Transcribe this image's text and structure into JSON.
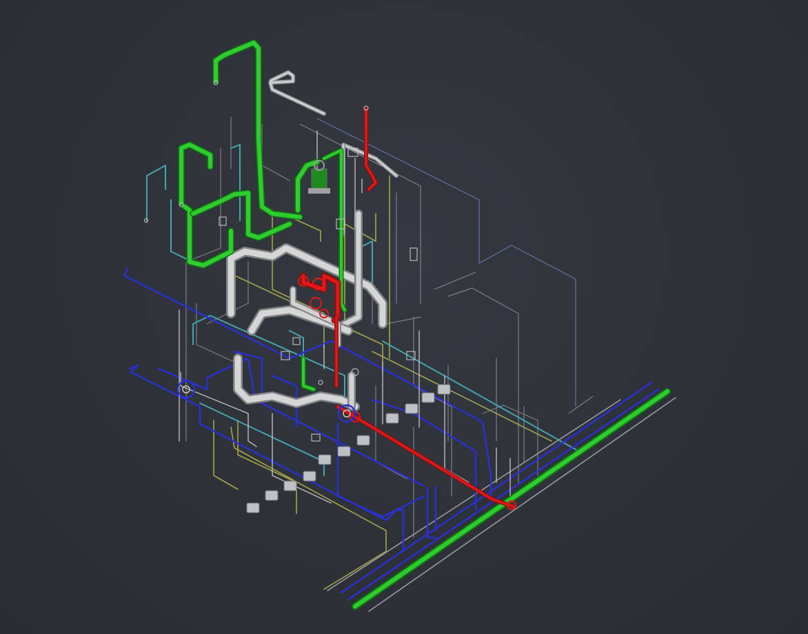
{
  "viewport": {
    "background": "#2e3238",
    "scene": "isometric-piping-model"
  },
  "colors": {
    "green": "#2ecc2e",
    "green_edge": "#0f7a0f",
    "blue": "#2a2fd6",
    "red": "#e01818",
    "cyan": "#46a6b0",
    "yellow": "#a8a64a",
    "white": "#c8c8c8",
    "gray": "#8e9094",
    "violet": "#6a6fa8"
  }
}
